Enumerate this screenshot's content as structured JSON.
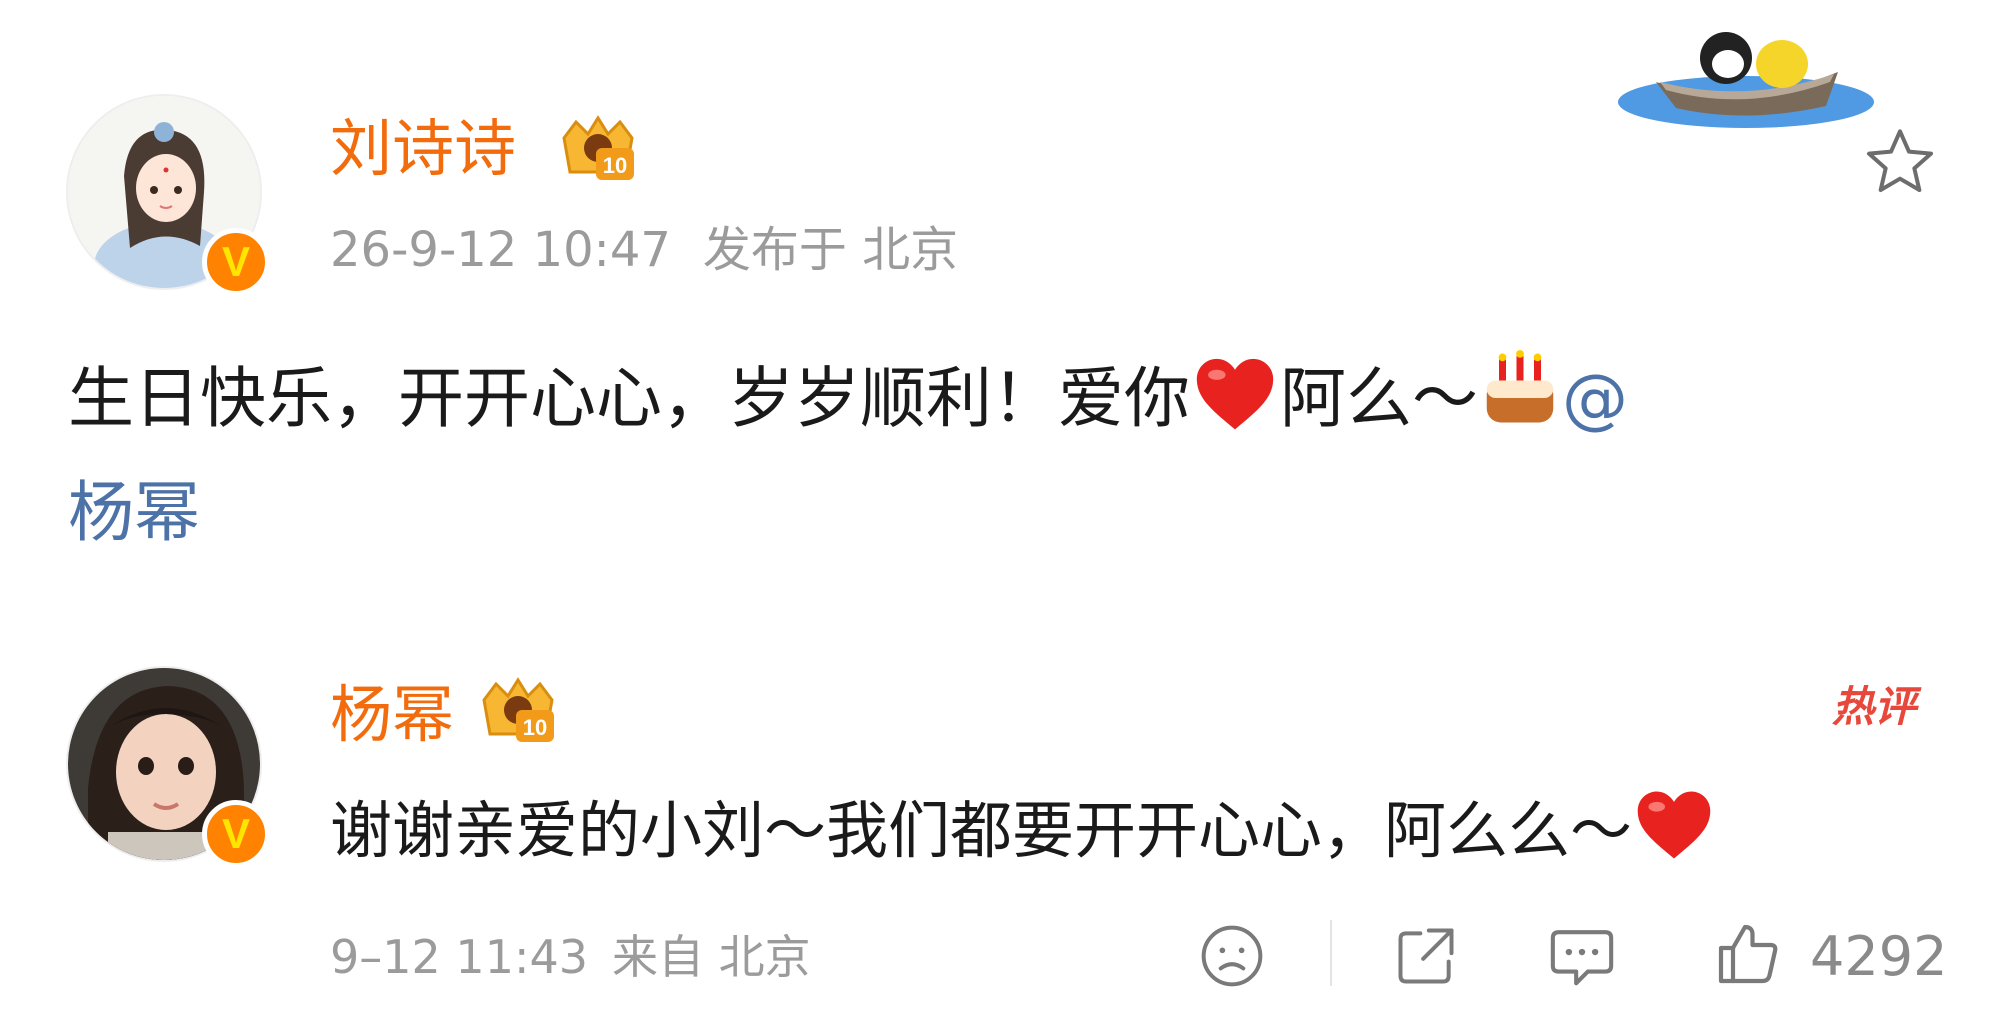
{
  "post": {
    "author": "刘诗诗",
    "member_level": "10",
    "timestamp": "26-9-12 10:47",
    "location": "发布于 北京",
    "text_main": "生日快乐，开开心心，岁岁顺利！爱你",
    "text_after_heart": "阿么～",
    "mention_at": "@",
    "mention_name": "杨幂",
    "verified_mark": "V"
  },
  "comment": {
    "author": "杨幂",
    "member_level": "10",
    "text": "谢谢亲爱的小刘～我们都要开开心心，阿么么～",
    "hot_label": "热评",
    "timestamp": "9–12 11:43",
    "location": "来自 北京",
    "like_count": "4292",
    "verified_mark": "V"
  },
  "icons": [
    "boat-sticker-icon",
    "star-icon",
    "crown-badge-icon",
    "heart-icon",
    "cake-icon",
    "sad-face-icon",
    "share-icon",
    "comment-icon",
    "thumbs-up-icon"
  ],
  "colors": {
    "username": "#f26c0d",
    "mention": "#4d72a8",
    "meta": "#9b9b9b",
    "hot": "#e8473b",
    "verified": "#ff8200"
  }
}
